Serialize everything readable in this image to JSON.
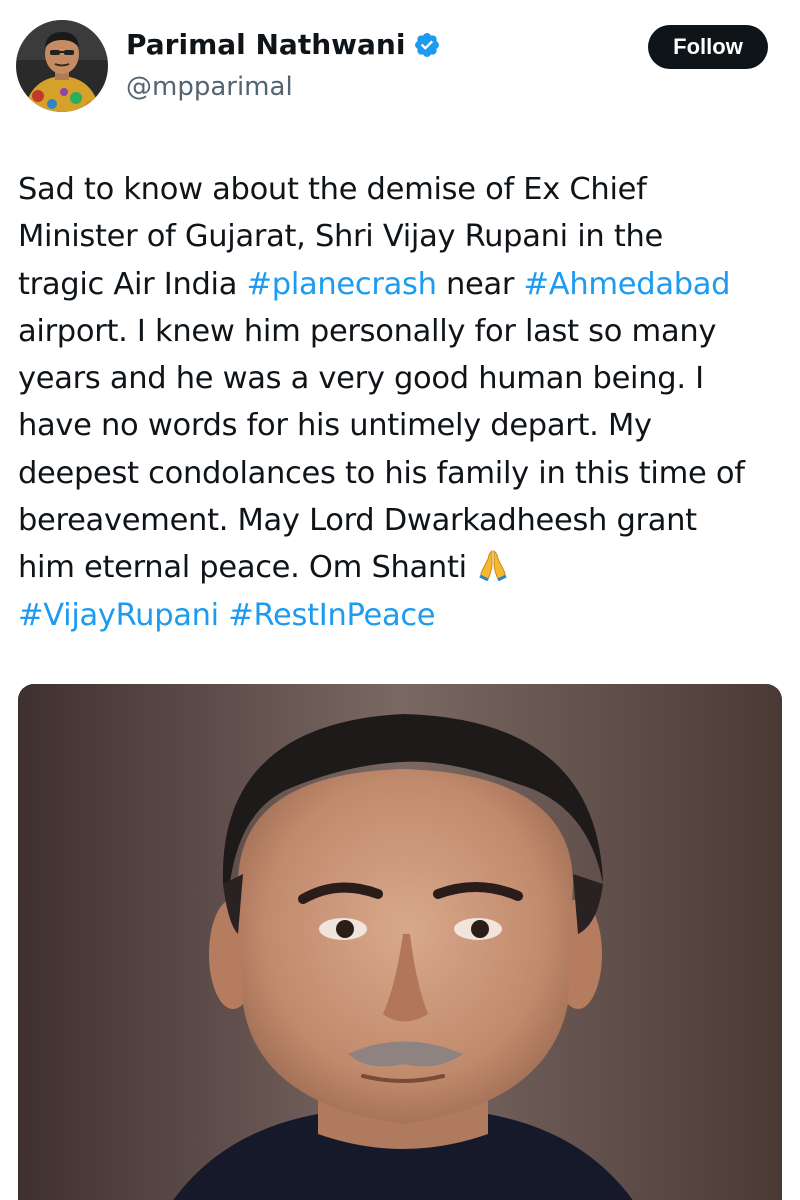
{
  "author": {
    "display_name": "Parimal Nathwani",
    "handle": "@mpparimal",
    "verified": true,
    "avatar_icon": "user-avatar-photo"
  },
  "follow_button": {
    "label": "Follow"
  },
  "tweet": {
    "lines": {
      "l1": "Sad to know about the demise of Ex Chief",
      "l2": "Minister of Gujarat, Shri Vijay Rupani in the",
      "l3a": "tragic Air India ",
      "l3b": "#planecrash",
      "l3c": " near ",
      "l3d": "#Ahmedabad",
      "l4": "airport. I knew him personally for last so many",
      "l5": "years and he was a very good human being. I",
      "l6": "have no words for his untimely depart. My",
      "l7": "deepest condolances to his family in this time of",
      "l8": "bereavement. May Lord Dwarkadheesh grant",
      "l9": "him eternal peace. Om Shanti ",
      "l10a": "#VijayRupani",
      "l10b": " ",
      "l10c": "#RestInPeace"
    },
    "emoji_icon": "folded-hands-icon"
  },
  "media": {
    "icon": "portrait-photo"
  },
  "colors": {
    "text": "#0f1419",
    "secondary": "#536471",
    "hashtag": "#1d9bf0",
    "verified": "#1d9bf0",
    "follow_bg": "#0f1419",
    "follow_text": "#ffffff"
  }
}
